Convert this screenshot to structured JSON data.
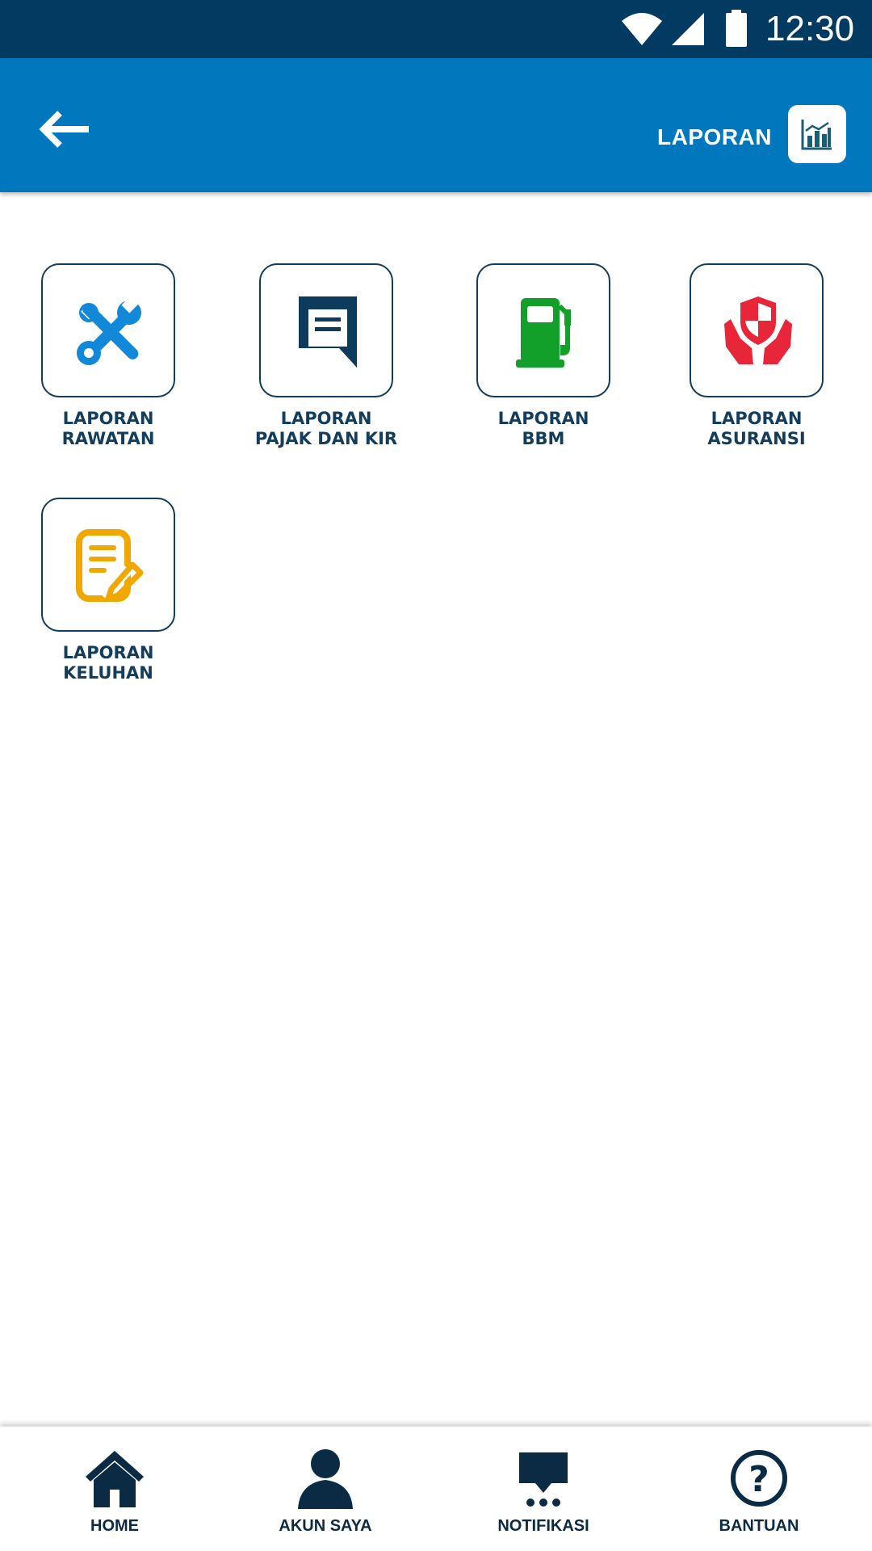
{
  "status_bar": {
    "time": "12:30",
    "icons": [
      "wifi-icon",
      "signal-icon",
      "battery-icon"
    ]
  },
  "app_bar": {
    "title": "LAPORAN",
    "back_icon": "arrow-left-icon",
    "title_icon": "bar-chart-icon"
  },
  "menu": {
    "items": [
      {
        "line1": "LAPORAN",
        "line2": "RAWATAN",
        "icon": "tools-icon",
        "color": "#1288d8"
      },
      {
        "line1": "LAPORAN",
        "line2": "PAJAK DAN KIR",
        "icon": "document-icon",
        "color": "#0d3b5d"
      },
      {
        "line1": "LAPORAN",
        "line2": "BBM",
        "icon": "fuel-pump-icon",
        "color": "#12a02a"
      },
      {
        "line1": "LAPORAN",
        "line2": "ASURANSI",
        "icon": "insurance-shield-icon",
        "color": "#e8263a"
      },
      {
        "line1": "LAPORAN",
        "line2": "KELUHAN",
        "icon": "complaint-note-icon",
        "color": "#f0a800"
      }
    ]
  },
  "bottom_nav": {
    "items": [
      {
        "label": "HOME",
        "icon": "home-icon"
      },
      {
        "label": "AKUN SAYA",
        "icon": "user-icon"
      },
      {
        "label": "NOTIFIKASI",
        "icon": "chat-icon"
      },
      {
        "label": "BANTUAN",
        "icon": "help-icon"
      }
    ]
  },
  "colors": {
    "status_bar": "#023a61",
    "app_bar": "#0178be",
    "tile_border": "#123d5c",
    "label": "#123d5c"
  }
}
